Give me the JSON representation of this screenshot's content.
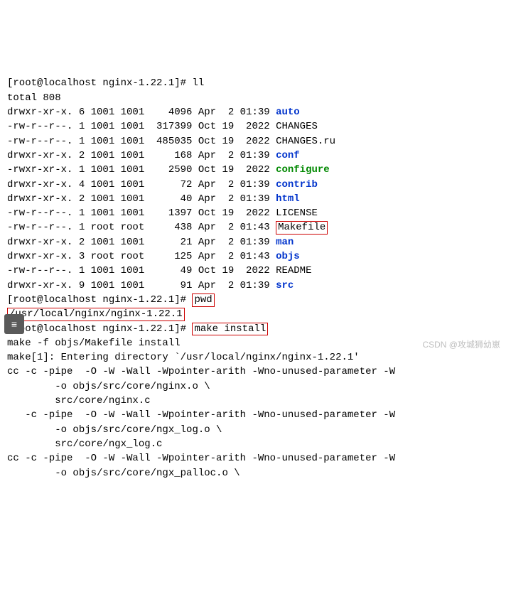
{
  "prompt1": "[root@localhost nginx-1.22.1]# ",
  "cmd1": "ll",
  "total": "total 808",
  "files": [
    {
      "perm": "drwxr-xr-x.",
      "ln": "6",
      "own": "1001",
      "grp": "1001",
      "size": "   4096",
      "date": "Apr  2 01:39",
      "name": "auto",
      "cls": "dir-blue",
      "boxed": false
    },
    {
      "perm": "-rw-r--r--.",
      "ln": "1",
      "own": "1001",
      "grp": "1001",
      "size": " 317399",
      "date": "Oct 19  2022",
      "name": "CHANGES",
      "cls": "",
      "boxed": false
    },
    {
      "perm": "-rw-r--r--.",
      "ln": "1",
      "own": "1001",
      "grp": "1001",
      "size": " 485035",
      "date": "Oct 19  2022",
      "name": "CHANGES.ru",
      "cls": "",
      "boxed": false
    },
    {
      "perm": "drwxr-xr-x.",
      "ln": "2",
      "own": "1001",
      "grp": "1001",
      "size": "    168",
      "date": "Apr  2 01:39",
      "name": "conf",
      "cls": "dir-blue",
      "boxed": false
    },
    {
      "perm": "-rwxr-xr-x.",
      "ln": "1",
      "own": "1001",
      "grp": "1001",
      "size": "   2590",
      "date": "Oct 19  2022",
      "name": "configure",
      "cls": "exec-green",
      "boxed": false
    },
    {
      "perm": "drwxr-xr-x.",
      "ln": "4",
      "own": "1001",
      "grp": "1001",
      "size": "     72",
      "date": "Apr  2 01:39",
      "name": "contrib",
      "cls": "dir-blue",
      "boxed": false
    },
    {
      "perm": "drwxr-xr-x.",
      "ln": "2",
      "own": "1001",
      "grp": "1001",
      "size": "     40",
      "date": "Apr  2 01:39",
      "name": "html",
      "cls": "dir-blue",
      "boxed": false
    },
    {
      "perm": "-rw-r--r--.",
      "ln": "1",
      "own": "1001",
      "grp": "1001",
      "size": "   1397",
      "date": "Oct 19  2022",
      "name": "LICENSE",
      "cls": "",
      "boxed": false
    },
    {
      "perm": "-rw-r--r--.",
      "ln": "1",
      "own": "root",
      "grp": "root",
      "size": "    438",
      "date": "Apr  2 01:43",
      "name": "Makefile",
      "cls": "",
      "boxed": true
    },
    {
      "perm": "drwxr-xr-x.",
      "ln": "2",
      "own": "1001",
      "grp": "1001",
      "size": "     21",
      "date": "Apr  2 01:39",
      "name": "man",
      "cls": "dir-blue",
      "boxed": false
    },
    {
      "perm": "drwxr-xr-x.",
      "ln": "3",
      "own": "root",
      "grp": "root",
      "size": "    125",
      "date": "Apr  2 01:43",
      "name": "objs",
      "cls": "dir-blue",
      "boxed": false
    },
    {
      "perm": "-rw-r--r--.",
      "ln": "1",
      "own": "1001",
      "grp": "1001",
      "size": "     49",
      "date": "Oct 19  2022",
      "name": "README",
      "cls": "",
      "boxed": false
    },
    {
      "perm": "drwxr-xr-x.",
      "ln": "9",
      "own": "1001",
      "grp": "1001",
      "size": "     91",
      "date": "Apr  2 01:39",
      "name": "src",
      "cls": "dir-blue",
      "boxed": false
    }
  ],
  "prompt2": "[root@localhost nginx-1.22.1]# ",
  "cmd2": "pwd",
  "pwd_out": "/usr/local/nginx/nginx-1.22.1",
  "prompt3": "[root@localhost nginx-1.22.1]# ",
  "cmd3": "make install",
  "make_lines": [
    "make -f objs/Makefile install",
    "make[1]: Entering directory `/usr/local/nginx/nginx-1.22.1'",
    "cc -c -pipe  -O -W -Wall -Wpointer-arith -Wno-unused-parameter -W",
    "        -o objs/src/core/nginx.o \\",
    "        src/core/nginx.c",
    "   -c -pipe  -O -W -Wall -Wpointer-arith -Wno-unused-parameter -W",
    "        -o objs/src/core/ngx_log.o \\",
    "        src/core/ngx_log.c",
    "cc -c -pipe  -O -W -Wall -Wpointer-arith -Wno-unused-parameter -W",
    "        -o objs/src/core/ngx_palloc.o \\"
  ],
  "watermark": "CSDN @攻城狮幼崽",
  "fab": "≡"
}
